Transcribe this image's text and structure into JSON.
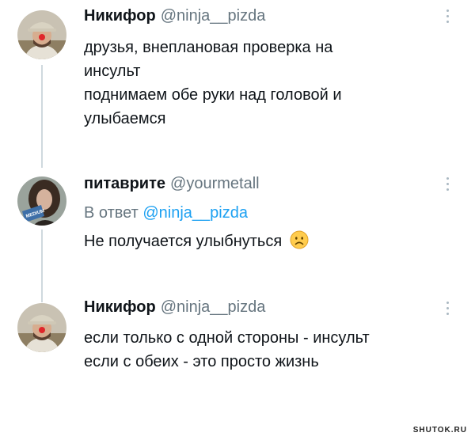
{
  "tweets": [
    {
      "name": "Никифор",
      "handle": "@ninja__pizda",
      "lines": [
        "друзья, внеплановая проверка на",
        "инсульт",
        "поднимаем обе руки над головой и",
        "улыбаемся"
      ],
      "avatar_icon": "user-avatar-cap-clown-nose"
    },
    {
      "name": "питаврите",
      "handle": "@yourmetall",
      "reply_prefix": "В ответ",
      "reply_handle": "@ninja__pizda",
      "lines": [
        "Не получается улыбнуться"
      ],
      "emoji": "frowning-face-icon",
      "avatar_icon": "user-avatar-hair-sign"
    },
    {
      "name": "Никифор",
      "handle": "@ninja__pizda",
      "lines": [
        "если только с одной стороны - инсульт",
        "если с обеих - это просто жизнь"
      ],
      "avatar_icon": "user-avatar-cap-clown-nose"
    }
  ],
  "watermark": "SHUTOK.RU",
  "colors": {
    "handle": "#66757f",
    "link": "#1da1f2",
    "thread_line": "#cfd9de"
  }
}
